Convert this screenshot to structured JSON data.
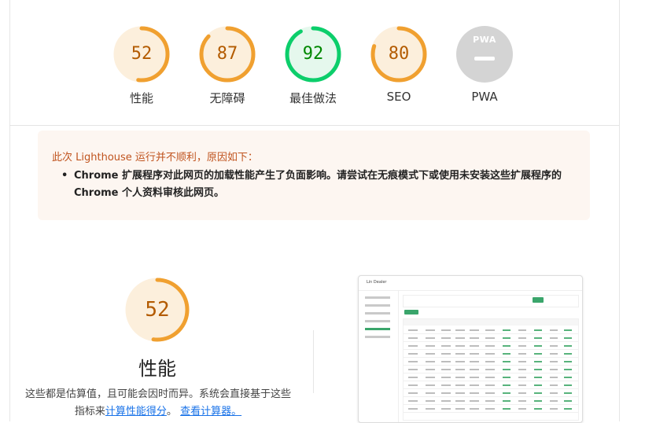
{
  "colors": {
    "orange": "#f0a030",
    "orange_text": "#b35b00",
    "orange_track": "#fcefdc",
    "green": "#0cce6b",
    "green_text": "#008800",
    "green_track": "#e5f8ed",
    "pwa_gray": "#d4d4d4",
    "warning_text": "#c0541f",
    "link": "#1a73e8"
  },
  "gauges": [
    {
      "score": "52",
      "label": "性能",
      "rating": "average"
    },
    {
      "score": "87",
      "label": "无障碍",
      "rating": "average"
    },
    {
      "score": "92",
      "label": "最佳做法",
      "rating": "pass"
    },
    {
      "score": "80",
      "label": "SEO",
      "rating": "average"
    },
    {
      "score": "",
      "label": "PWA",
      "rating": "pwa",
      "badge_text": "PWA"
    }
  ],
  "warning": {
    "title": "此次 Lighthouse 运行并不顺利，原因如下：",
    "items": [
      "Chrome 扩展程序对此网页的加载性能产生了负面影响。请尝试在无痕模式下或使用未安装这些扩展程序的 Chrome 个人资料审核此网页。"
    ]
  },
  "performance": {
    "score": "52",
    "title": "性能",
    "desc_prefix": "这些都是估算值，且可能会因时而异。系统会直接基于这些指标来",
    "link_calc": "计算性能得分",
    "sep": "。",
    "link_view": "查看计算器。"
  },
  "thumbnail": {
    "brand": "Lin Dealer"
  }
}
